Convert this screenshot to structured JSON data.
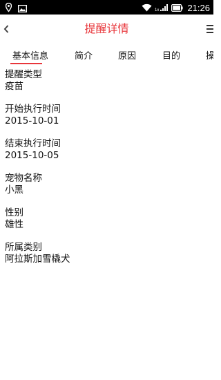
{
  "status_bar": {
    "time": "21:26",
    "network_label": "1x",
    "icons": [
      "location-pin-icon",
      "image-icon",
      "wifi-icon",
      "signal-icon",
      "battery-icon"
    ]
  },
  "header": {
    "title": "提醒详情",
    "back_icon": "chevron-left-icon",
    "menu_icon": "menu-icon"
  },
  "tabs": [
    {
      "label": "基本信息",
      "active": true
    },
    {
      "label": "简介",
      "active": false
    },
    {
      "label": "原因",
      "active": false
    },
    {
      "label": "目的",
      "active": false
    },
    {
      "label": "操",
      "active": false
    }
  ],
  "details": [
    {
      "label": "提醒类型",
      "value": "疫苗"
    },
    {
      "label": "开始执行时间",
      "value": "2015-10-01"
    },
    {
      "label": "结束执行时间",
      "value": "2015-10-05"
    },
    {
      "label": "宠物名称",
      "value": "小黑"
    },
    {
      "label": "性别",
      "value": "雄性"
    },
    {
      "label": "所属类别",
      "value": "阿拉斯加雪橇犬"
    }
  ],
  "colors": {
    "accent": "#e8363b",
    "status_bar_bg": "#000000",
    "text": "#111111",
    "background": "#ffffff"
  }
}
